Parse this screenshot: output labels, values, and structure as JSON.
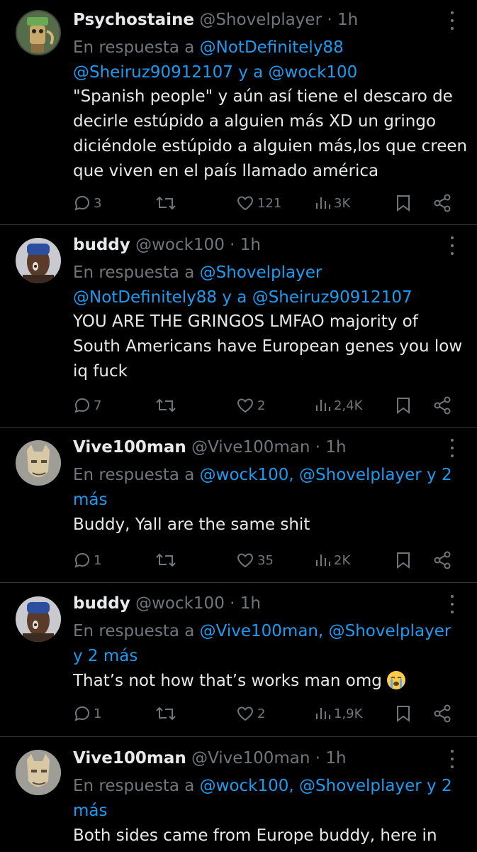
{
  "tweets": [
    {
      "name": "Psychostaine",
      "handle": "@Shovelplayer",
      "time": "1h",
      "reply_prefix": "En respuesta a",
      "reply_mentions_1": "@NotDefinitely88",
      "reply_mentions_2": "@Sheiruz90912107",
      "reply_joiner": "y a",
      "reply_mentions_3": "@wock100",
      "text": "\"Spanish people\" y aún así tiene el descaro de decirle estúpido a alguien más XD un gringo diciéndole estúpido a alguien más,los que creen que viven en el país llamado américa",
      "replies": "3",
      "reposts": "",
      "likes": "121",
      "views": "3K"
    },
    {
      "name": "buddy",
      "handle": "@wock100",
      "time": "1h",
      "reply_prefix": "En respuesta a",
      "reply_mentions_1": "@Shovelplayer",
      "reply_mentions_2": "@NotDefinitely88",
      "reply_joiner": "y a",
      "reply_mentions_3": "@Sheiruz90912107",
      "text": "YOU ARE THE GRINGOS LMFAO majority of South Americans have European genes you low iq fuck",
      "replies": "7",
      "reposts": "",
      "likes": "2",
      "views": "2,4K"
    },
    {
      "name": "Vive100man",
      "handle": "@Vive100man",
      "time": "1h",
      "reply_prefix": "En respuesta a",
      "reply_mentions_1": "@wock100, @Shovelplayer y 2",
      "reply_mentions_2": "más",
      "text": "Buddy, Yall are the same shit",
      "replies": "1",
      "reposts": "",
      "likes": "35",
      "views": "2K"
    },
    {
      "name": "buddy",
      "handle": "@wock100",
      "time": "1h",
      "reply_prefix": "En respuesta a",
      "reply_mentions_1": "@Vive100man, @Shovelplayer",
      "reply_mentions_2": "y 2 más",
      "text": "That’s not how that’s works man omg",
      "emoji": "loudly-crying-face",
      "replies": "1",
      "reposts": "",
      "likes": "2",
      "views": "1,9K"
    },
    {
      "name": "Vive100man",
      "handle": "@Vive100man",
      "time": "1h",
      "reply_prefix": "En respuesta a",
      "reply_mentions_1": "@wock100, @Shovelplayer y 2",
      "reply_mentions_2": "más",
      "text": "Both sides came from Europe buddy, here in"
    }
  ],
  "colors": {
    "background": "#000000",
    "text": "#e7e9ea",
    "secondary": "#71767b",
    "link": "#1d9bf0",
    "separator": "#2f3336"
  }
}
